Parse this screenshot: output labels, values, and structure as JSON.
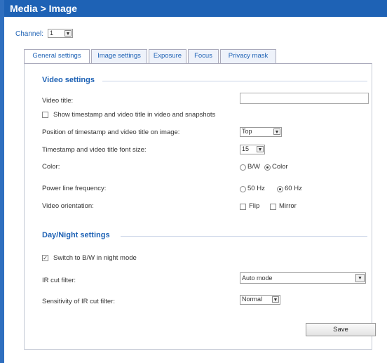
{
  "header": {
    "title": "Media > Image"
  },
  "channel": {
    "label": "Channel:",
    "value": "1"
  },
  "tabs": [
    {
      "label": "General settings",
      "active": true
    },
    {
      "label": "Image settings",
      "active": false
    },
    {
      "label": "Exposure",
      "active": false
    },
    {
      "label": "Focus",
      "active": false
    },
    {
      "label": "Privacy mask",
      "active": false
    }
  ],
  "video_settings": {
    "title": "Video settings",
    "video_title_label": "Video title:",
    "video_title_value": "",
    "show_timestamp_label": "Show timestamp and video title in video and snapshots",
    "show_timestamp_checked": false,
    "position_label": "Position of timestamp and video title on image:",
    "position_value": "Top",
    "fontsize_label": "Timestamp and video title font size:",
    "fontsize_value": "15",
    "color_label": "Color:",
    "color_bw_label": "B/W",
    "color_color_label": "Color",
    "color_selected": "Color",
    "power_label": "Power line frequency:",
    "power_50_label": "50 Hz",
    "power_60_label": "60 Hz",
    "power_selected": "60 Hz",
    "orientation_label": "Video orientation:",
    "flip_label": "Flip",
    "mirror_label": "Mirror",
    "flip_checked": false,
    "mirror_checked": false
  },
  "daynight_settings": {
    "title": "Day/Night settings",
    "switch_bw_label": "Switch to B/W in night mode",
    "switch_bw_checked": true,
    "ir_filter_label": "IR cut filter:",
    "ir_filter_value": "Auto mode",
    "sensitivity_label": "Sensitivity of IR cut filter:",
    "sensitivity_value": "Normal"
  },
  "actions": {
    "save_label": "Save"
  },
  "colors": {
    "accent": "#1e62b5",
    "leftbar": "#2f6fbf"
  }
}
